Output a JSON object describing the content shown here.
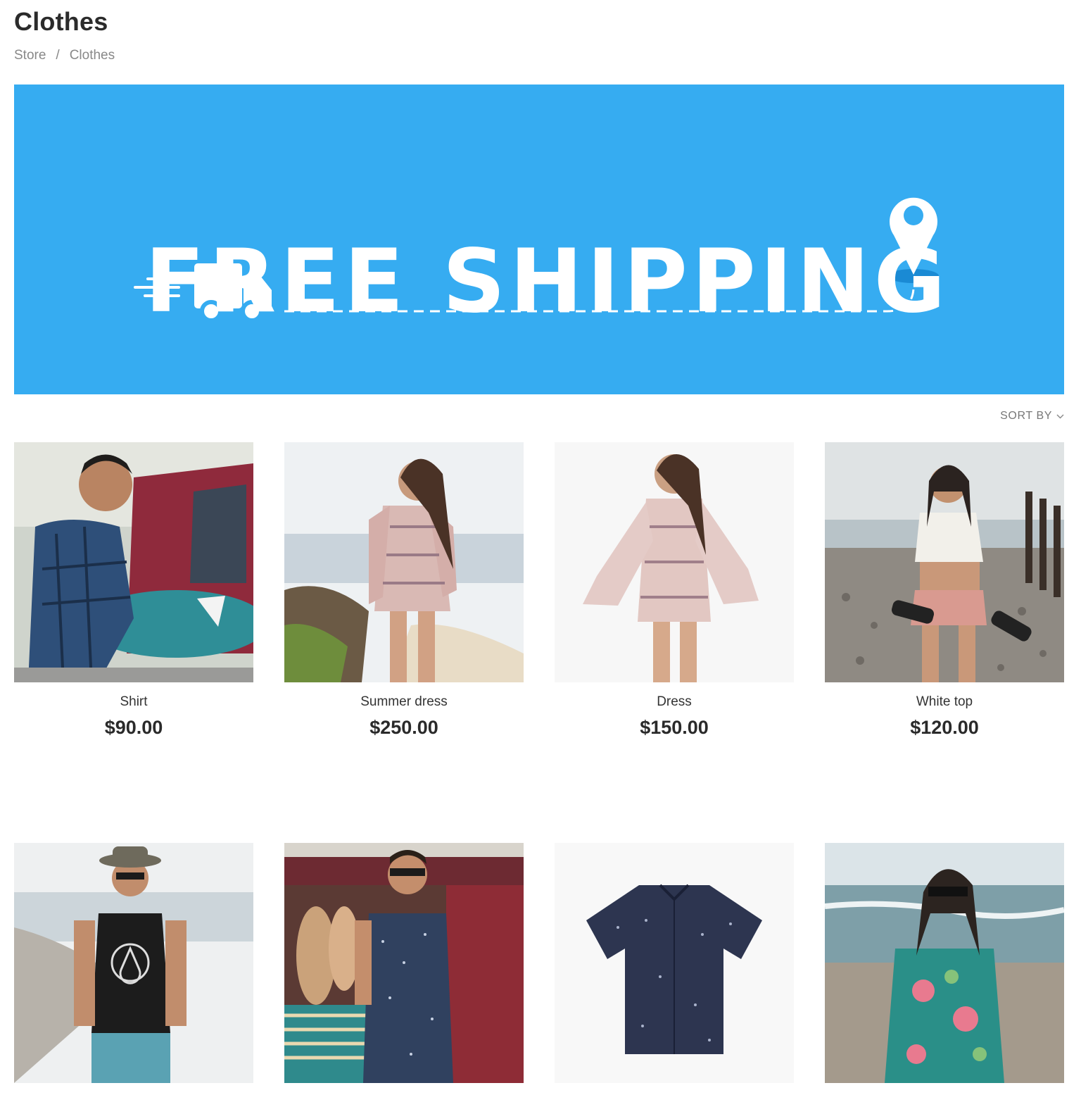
{
  "page": {
    "title": "Clothes"
  },
  "breadcrumb": {
    "items": [
      "Store",
      "Clothes"
    ],
    "separator": "/"
  },
  "banner": {
    "text": "FREE SHIPPING",
    "background": "#36acf1"
  },
  "sort": {
    "label": "SORT BY"
  },
  "products": [
    {
      "name": "Shirt",
      "price": "$90.00"
    },
    {
      "name": "Summer dress",
      "price": "$250.00"
    },
    {
      "name": "Dress",
      "price": "$150.00"
    },
    {
      "name": "White top",
      "price": "$120.00"
    },
    {
      "name": "",
      "price": ""
    },
    {
      "name": "",
      "price": ""
    },
    {
      "name": "",
      "price": ""
    },
    {
      "name": "",
      "price": ""
    }
  ]
}
